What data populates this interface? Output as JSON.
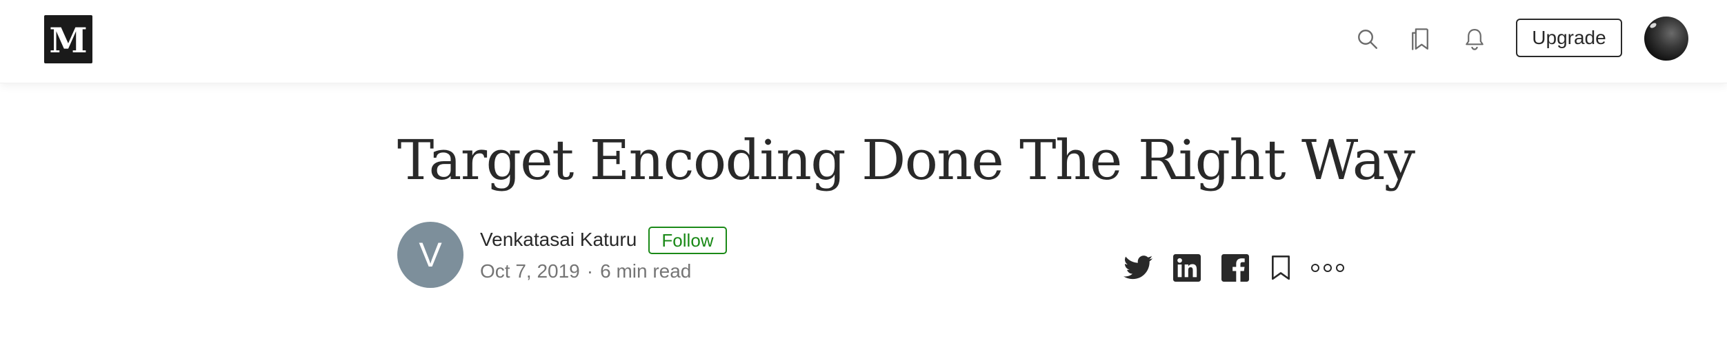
{
  "header": {
    "logo_letter": "M",
    "logo_icon": "medium-logo-icon",
    "search_icon": "search-icon",
    "reading_list_icon": "bookmarks-icon",
    "notifications_icon": "bell-icon",
    "upgrade_label": "Upgrade",
    "user_avatar": "user-avatar"
  },
  "article": {
    "title": "Target Encoding Done The Right Way",
    "author": {
      "initial": "V",
      "name": "Venkatasai Katuru",
      "follow_label": "Follow"
    },
    "date": "Oct 7, 2019",
    "separator": "·",
    "read_time": "6 min read"
  },
  "share": {
    "icons": [
      "twitter-icon",
      "linkedin-icon",
      "facebook-icon",
      "bookmark-icon",
      "more-icon"
    ]
  },
  "colors": {
    "text": "#292929",
    "muted": "#757575",
    "accent_green": "#1a8917",
    "author_avatar_bg": "#7d8f9b",
    "logo_bg": "#1a1a1a"
  }
}
